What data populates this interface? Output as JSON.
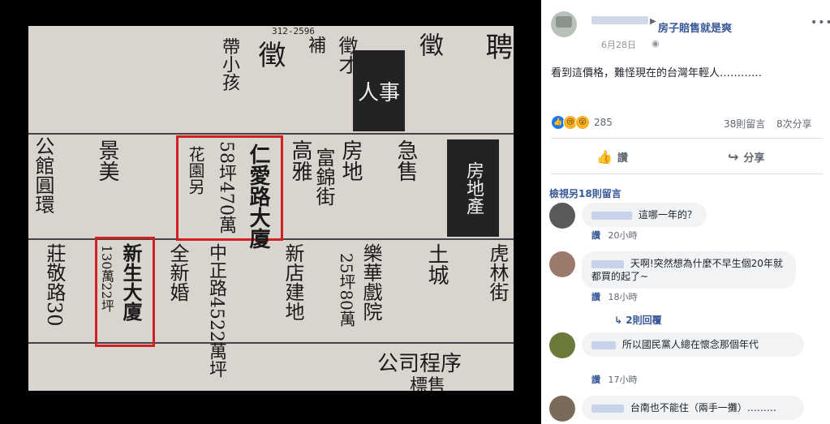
{
  "post": {
    "page_name": "房子賠售就是爽",
    "date": "6月28日",
    "globe_icon": "globe-icon",
    "more_label": "•••",
    "text": "看到這價格，難怪現在的台灣年輕人…………",
    "reaction_count": "285",
    "comments_label": "38則留言",
    "shares_label": "8次分享",
    "like_button": "讚",
    "share_button": "分享",
    "view_more": "檢視另18則留言"
  },
  "newspaper": {
    "header_phone": "312-2596",
    "banner_ad": "人事",
    "banner_estate": "房地產",
    "ad1_title": "仁愛路大廈",
    "ad1_detail": "58坪470萬",
    "ad1_sub": "花園另",
    "ad2_title": "新生大廈",
    "ad2_detail": "130萬22坪",
    "col_texts": [
      "聘",
      "徵",
      "徵才",
      "補",
      "徵",
      "帶小孩",
      "高雅",
      "富錦街",
      "房地",
      "急售",
      "景美",
      "公館圓環",
      "莊敬路30",
      "全新婚",
      "中正路4522萬坪",
      "新店建地",
      "樂華戲院",
      "25坪80萬",
      "土城",
      "虎林街",
      "公司程序",
      "標售"
    ]
  },
  "comments": [
    {
      "text": "這哪一年的？",
      "like": "讚",
      "time": "20小時"
    },
    {
      "text": "天啊!突然想為什麼不早生個20年就都買的起了~",
      "like": "讚",
      "time": "18小時",
      "replies": "2則回覆"
    },
    {
      "text": "所以國民黨人總在懷念那個年代",
      "like": "讚",
      "time": "17小時"
    },
    {
      "text": "台南也不能住（兩手一攤）………",
      "like": "讚",
      "time": ""
    }
  ]
}
